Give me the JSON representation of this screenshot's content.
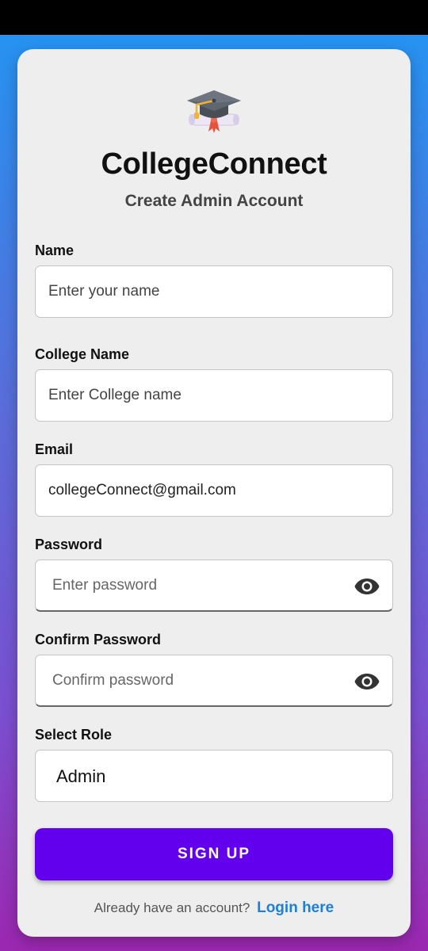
{
  "header": {
    "app_title": "CollegeConnect",
    "subtitle": "Create Admin Account"
  },
  "form": {
    "name": {
      "label": "Name",
      "value": "",
      "placeholder": "Enter your name"
    },
    "college_name": {
      "label": "College Name",
      "value": "",
      "placeholder": "Enter College name"
    },
    "email": {
      "label": "Email",
      "value": "collegeConnect@gmail.com",
      "placeholder": ""
    },
    "password": {
      "label": "Password",
      "value": "",
      "placeholder": "Enter password"
    },
    "confirm_password": {
      "label": "Confirm Password",
      "value": "",
      "placeholder": "Confirm password"
    },
    "role": {
      "label": "Select Role",
      "selected": "Admin"
    }
  },
  "actions": {
    "signup_label": "SIGN UP",
    "login_prompt": "Already have an account?",
    "login_link": "Login here"
  },
  "icons": {
    "logo": "graduation-cap-icon",
    "password_toggle": "eye-icon"
  },
  "colors": {
    "primary": "#6200ee",
    "link": "#1e7fd6",
    "card": "#eeeeee"
  }
}
